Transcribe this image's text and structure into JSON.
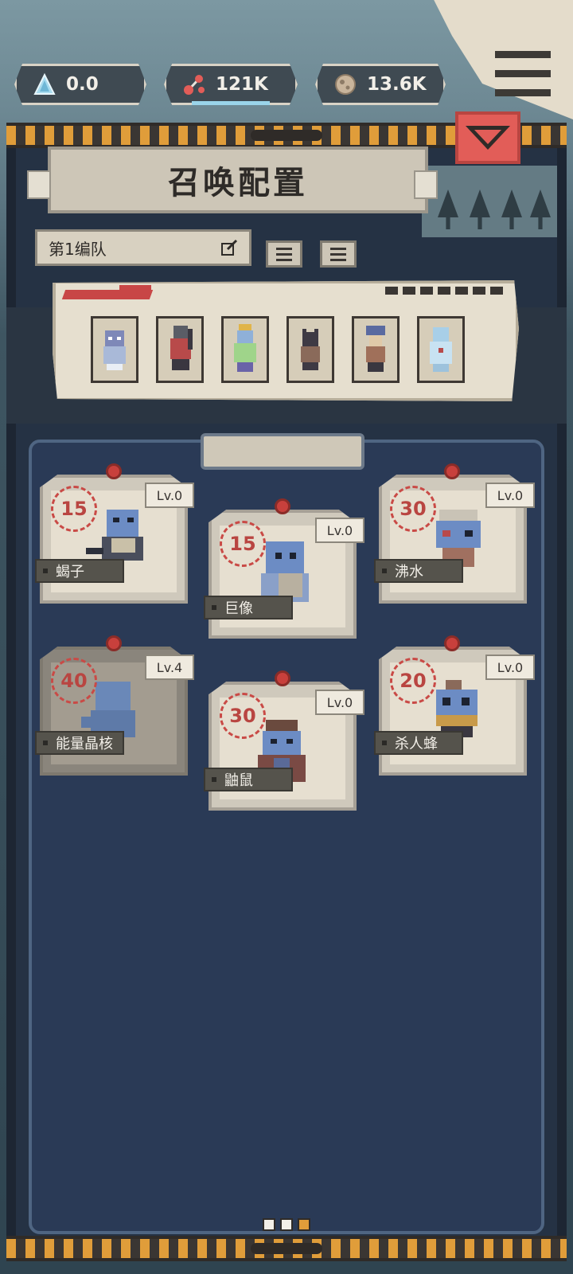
{
  "resources": [
    {
      "icon": "crystal-icon",
      "value": "0.0"
    },
    {
      "icon": "molecule-icon",
      "value": "121K"
    },
    {
      "icon": "ore-icon",
      "value": "13.6K"
    }
  ],
  "colors": {
    "accent_red": "#e25d58",
    "hazard_orange": "#e09d3a",
    "board_blue": "#2a3a56",
    "cost_red": "#b94541"
  },
  "panel": {
    "title": "召唤配置"
  },
  "team": {
    "current": "第1编队"
  },
  "cards": [
    {
      "cost": "15",
      "level": "Lv.0",
      "name": "蝎子"
    },
    {
      "cost": "15",
      "level": "Lv.0",
      "name": "巨像"
    },
    {
      "cost": "30",
      "level": "Lv.0",
      "name": "沸水"
    },
    {
      "cost": "40",
      "level": "Lv.4",
      "name": "能量晶核"
    },
    {
      "cost": "30",
      "level": "Lv.0",
      "name": "鼬鼠"
    },
    {
      "cost": "20",
      "level": "Lv.0",
      "name": "杀人蜂"
    }
  ]
}
